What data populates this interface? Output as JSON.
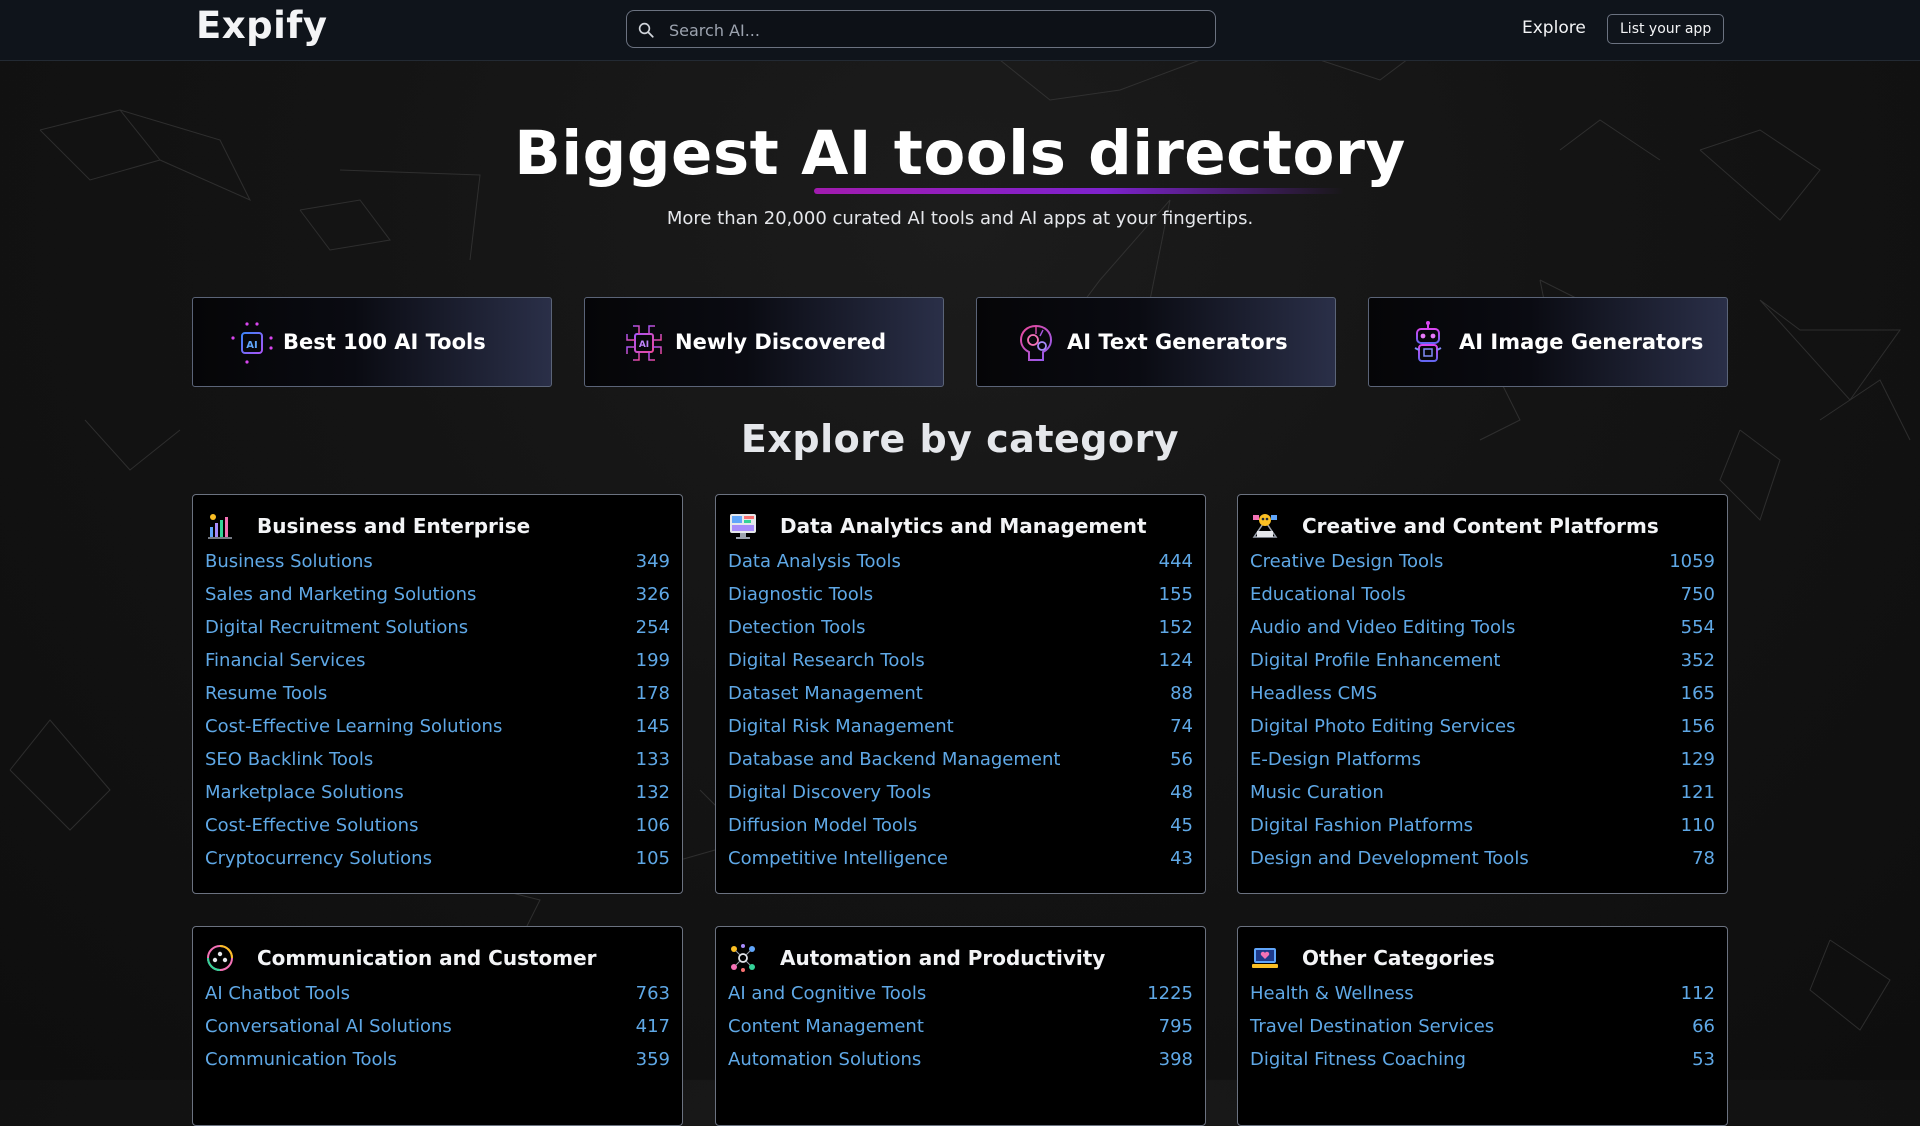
{
  "header": {
    "logo": "Expify",
    "search_placeholder": "Search AI...",
    "nav_explore": "Explore",
    "nav_list_app": "List your app"
  },
  "hero": {
    "title_pre": "Biggest ",
    "title_highlight": "AI tools directory",
    "subtitle": "More than 20,000 curated AI tools and AI apps at your fingertips."
  },
  "featured": [
    {
      "label": "Best 100 AI Tools",
      "icon": "ai-chip-icon"
    },
    {
      "label": "Newly Discovered",
      "icon": "ai-circuit-icon"
    },
    {
      "label": "AI Text Generators",
      "icon": "brain-gear-icon"
    },
    {
      "label": "AI Image Generators",
      "icon": "robot-icon"
    }
  ],
  "explore_title": "Explore by category",
  "categories": [
    {
      "title": "Business and Enterprise",
      "icon": "business-chart-icon",
      "items": [
        {
          "name": "Business Solutions",
          "count": "349"
        },
        {
          "name": "Sales and Marketing Solutions",
          "count": "326"
        },
        {
          "name": "Digital Recruitment Solutions",
          "count": "254"
        },
        {
          "name": "Financial Services",
          "count": "199"
        },
        {
          "name": "Resume Tools",
          "count": "178"
        },
        {
          "name": "Cost-Effective Learning Solutions",
          "count": "145"
        },
        {
          "name": "SEO Backlink Tools",
          "count": "133"
        },
        {
          "name": "Marketplace Solutions",
          "count": "132"
        },
        {
          "name": "Cost-Effective Solutions",
          "count": "106"
        },
        {
          "name": "Cryptocurrency Solutions",
          "count": "105"
        }
      ]
    },
    {
      "title": "Data Analytics and Management",
      "icon": "analytics-monitor-icon",
      "items": [
        {
          "name": "Data Analysis Tools",
          "count": "444"
        },
        {
          "name": "Diagnostic Tools",
          "count": "155"
        },
        {
          "name": "Detection Tools",
          "count": "152"
        },
        {
          "name": "Digital Research Tools",
          "count": "124"
        },
        {
          "name": "Dataset Management",
          "count": "88"
        },
        {
          "name": "Digital Risk Management",
          "count": "74"
        },
        {
          "name": "Database and Backend Management",
          "count": "56"
        },
        {
          "name": "Digital Discovery Tools",
          "count": "48"
        },
        {
          "name": "Diffusion Model Tools",
          "count": "45"
        },
        {
          "name": "Competitive Intelligence",
          "count": "43"
        }
      ]
    },
    {
      "title": "Creative and Content Platforms",
      "icon": "creative-palette-icon",
      "items": [
        {
          "name": "Creative Design Tools",
          "count": "1059"
        },
        {
          "name": "Educational Tools",
          "count": "750"
        },
        {
          "name": "Audio and Video Editing Tools",
          "count": "554"
        },
        {
          "name": "Digital Profile Enhancement",
          "count": "352"
        },
        {
          "name": "Headless CMS",
          "count": "165"
        },
        {
          "name": "Digital Photo Editing Services",
          "count": "156"
        },
        {
          "name": "E-Design Platforms",
          "count": "129"
        },
        {
          "name": "Music Curation",
          "count": "121"
        },
        {
          "name": "Digital Fashion Platforms",
          "count": "110"
        },
        {
          "name": "Design and Development Tools",
          "count": "78"
        }
      ]
    },
    {
      "title": "Communication and Customer",
      "icon": "community-circle-icon",
      "items": [
        {
          "name": "AI Chatbot Tools",
          "count": "763"
        },
        {
          "name": "Conversational AI Solutions",
          "count": "417"
        },
        {
          "name": "Communication Tools",
          "count": "359"
        }
      ]
    },
    {
      "title": "Automation and Productivity",
      "icon": "automation-network-icon",
      "items": [
        {
          "name": "AI and Cognitive Tools",
          "count": "1225"
        },
        {
          "name": "Content Management",
          "count": "795"
        },
        {
          "name": "Automation Solutions",
          "count": "398"
        }
      ]
    },
    {
      "title": "Other Categories",
      "icon": "laptop-heart-icon",
      "items": [
        {
          "name": "Health & Wellness",
          "count": "112"
        },
        {
          "name": "Travel Destination Services",
          "count": "66"
        },
        {
          "name": "Digital Fitness Coaching",
          "count": "53"
        }
      ]
    }
  ]
}
